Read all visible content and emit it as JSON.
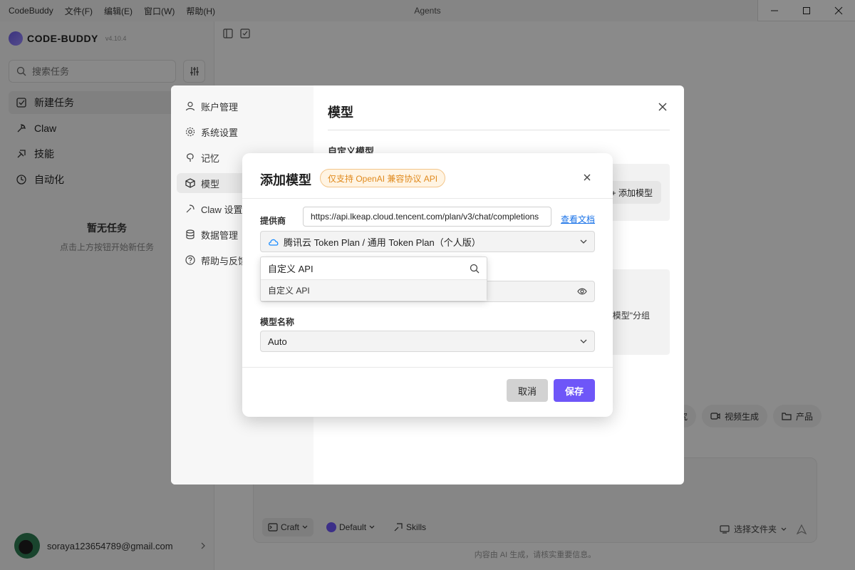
{
  "titlebar": {
    "menu": [
      "CodeBuddy",
      "文件(F)",
      "编辑(E)",
      "窗口(W)",
      "帮助(H)"
    ],
    "window_title": "Agents"
  },
  "sidebar": {
    "logo_text": "CODE-BUDDY",
    "version": "v4.10.4",
    "search_placeholder": "搜索任务",
    "nav": [
      {
        "label": "新建任务",
        "icon": "new-task-icon"
      },
      {
        "label": "Claw",
        "icon": "claw-icon"
      },
      {
        "label": "技能",
        "icon": "skills-icon"
      },
      {
        "label": "自动化",
        "icon": "clock-icon"
      }
    ],
    "empty_title": "暂无任务",
    "empty_sub": "点击上方按钮开始新任务",
    "user_email": "soraya123654789@gmail.com"
  },
  "main": {
    "chips": [
      "究",
      "视频生成",
      "产品"
    ],
    "composer": {
      "mode": "Craft",
      "model": "Default",
      "skills": "Skills",
      "folder": "选择文件夹"
    },
    "disclaimer": "内容由 AI 生成，请核实重要信息。"
  },
  "settings": {
    "nav": [
      {
        "label": "账户管理",
        "icon": "user-icon"
      },
      {
        "label": "系统设置",
        "icon": "gear-icon"
      },
      {
        "label": "记忆",
        "icon": "brain-icon"
      },
      {
        "label": "模型",
        "icon": "cube-icon"
      },
      {
        "label": "Claw 设置",
        "icon": "claw-icon"
      },
      {
        "label": "数据管理",
        "icon": "database-icon"
      },
      {
        "label": "帮助与反馈",
        "icon": "help-icon"
      }
    ],
    "title": "模型",
    "custom_model_label": "自定义模型",
    "add_model_button": "+ 添加模型",
    "info_text": "模型\"分组"
  },
  "dialog": {
    "title": "添加模型",
    "badge": "仅支持 OpenAI 兼容协议 API",
    "provider_label": "提供商",
    "url_value": "https://api.lkeap.cloud.tencent.com/plan/v3/chat/completions",
    "docs_link": "查看文档",
    "provider_selected": "腾讯云 Token Plan / 通用 Token Plan（个人版）",
    "dropdown_search": "自定义 API",
    "dropdown_option": "自定义 API",
    "model_name_label": "模型名称",
    "model_name_value": "Auto",
    "cancel": "取消",
    "save": "保存",
    "accent": "#6e56f8"
  }
}
